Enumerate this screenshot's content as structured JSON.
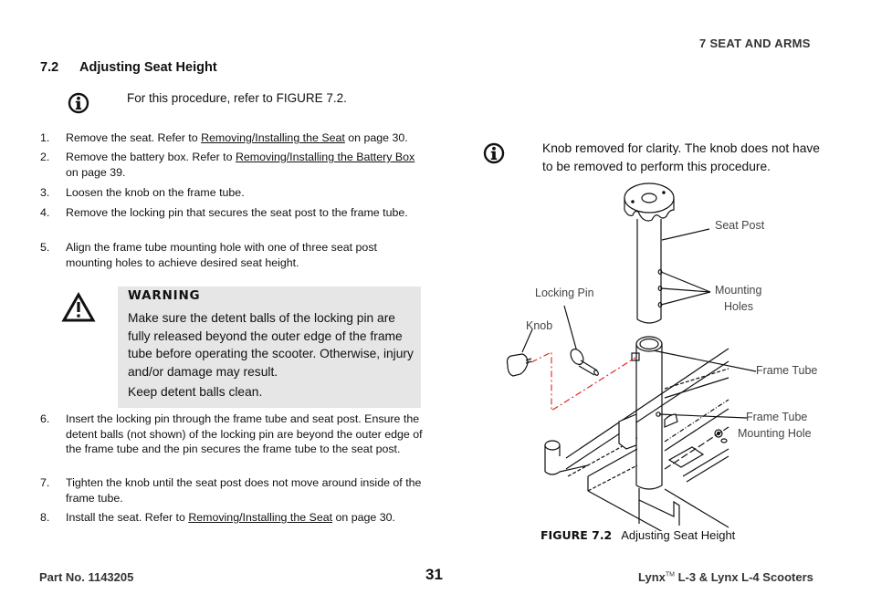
{
  "header": {
    "chapter": "7   SEAT AND ARMS"
  },
  "section": {
    "number": "7.2",
    "title": "Adjusting Seat Height"
  },
  "note_1": {
    "icon": "info-icon",
    "text": "For this procedure, refer to FIGURE 7.2."
  },
  "steps_a": [
    {
      "num": "1.",
      "pre": "Remove the seat. Refer to ",
      "link": "Removing/Installing the Seat",
      "post": " on page 30."
    },
    {
      "num": "2.",
      "pre": "Remove the battery box. Refer to ",
      "link": "Removing/Installing the Battery Box",
      "post": " on page 39."
    },
    {
      "num": "3.",
      "pre": "Loosen the knob on the frame tube.",
      "link": "",
      "post": ""
    },
    {
      "num": "4.",
      "pre": "Remove the locking pin that secures the seat post to the frame tube.",
      "link": "",
      "post": ""
    },
    {
      "num": "5.",
      "pre": "Align the frame tube mounting hole with one of three seat post mounting holes to achieve desired seat height.",
      "link": "",
      "post": ""
    }
  ],
  "warning": {
    "icon": "warning-triangle-icon",
    "title": "WARNING",
    "text": "Make sure the detent balls of the locking pin are fully released beyond the outer edge of the frame tube before operating the scooter. Otherwise, injury and/or damage may result.",
    "text2": "Keep detent balls clean."
  },
  "steps_b": [
    {
      "num": "6.",
      "pre": "Insert the locking pin through the frame tube and seat post. Ensure the detent balls (not shown) of the locking pin are beyond the outer edge of the frame tube and the pin secures the frame tube to the seat post.",
      "link": "",
      "post": ""
    },
    {
      "num": "7.",
      "pre": "Tighten the knob until the seat post does not move around inside of the frame tube.",
      "link": "",
      "post": ""
    },
    {
      "num": "8.",
      "pre": "Install the seat. Refer to ",
      "link": "Removing/Installing the Seat",
      "post": " on page 30."
    }
  ],
  "note_2": {
    "icon": "info-icon",
    "text": "Knob removed for clarity. The knob does not have to be removed to perform this procedure."
  },
  "figure": {
    "labels": {
      "seat_post": "Seat Post",
      "mounting_holes_1": "Mounting",
      "mounting_holes_2": "Holes",
      "locking_pin": "Locking Pin",
      "knob": "Knob",
      "frame_tube": "Frame Tube",
      "frame_tube_mounting_hole_1": "Frame Tube",
      "frame_tube_mounting_hole_2": "Mounting Hole"
    },
    "caption_label": "FIGURE 7.2",
    "caption_text": "Adjusting Seat Height",
    "accent_color": "#e0201c"
  },
  "footer": {
    "part_no": "Part No. 1143205",
    "page": "31",
    "product_pre": "Lynx",
    "product_tm": "TM",
    "product_post": " L-3 & Lynx L-4 Scooters"
  }
}
